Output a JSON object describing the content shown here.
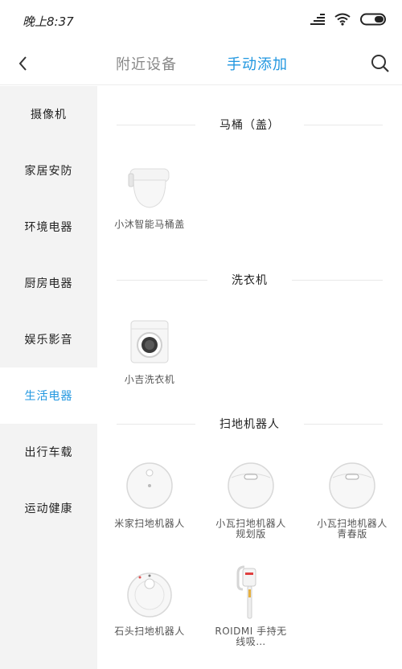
{
  "status": {
    "time": "晚上8:37"
  },
  "header": {
    "tab_nearby": "附近设备",
    "tab_manual": "手动添加"
  },
  "sidebar": {
    "items": [
      {
        "label": "摄像机"
      },
      {
        "label": "家居安防"
      },
      {
        "label": "环境电器"
      },
      {
        "label": "厨房电器"
      },
      {
        "label": "娱乐影音"
      },
      {
        "label": "生活电器"
      },
      {
        "label": "出行车载"
      },
      {
        "label": "运动健康"
      }
    ],
    "active_index": 5
  },
  "sections": [
    {
      "title": "马桶（盖）",
      "devices": [
        {
          "name": "小沐智能马桶盖",
          "icon": "toilet-seat-icon"
        }
      ]
    },
    {
      "title": "洗衣机",
      "devices": [
        {
          "name": "小吉洗衣机",
          "icon": "washing-machine-icon"
        }
      ]
    },
    {
      "title": "扫地机器人",
      "devices": [
        {
          "name": "米家扫地机器人",
          "icon": "robot-vacuum-icon"
        },
        {
          "name": "小瓦扫地机器人规划版",
          "icon": "robot-vacuum-icon"
        },
        {
          "name": "小瓦扫地机器人青春版",
          "icon": "robot-vacuum-icon"
        },
        {
          "name": "石头扫地机器人",
          "icon": "robot-vacuum-icon"
        },
        {
          "name": "ROIDMI 手持无线吸…",
          "icon": "handheld-vacuum-icon"
        }
      ]
    }
  ],
  "colors": {
    "accent": "#2197e0",
    "sidebar_bg": "#f3f3f3"
  }
}
